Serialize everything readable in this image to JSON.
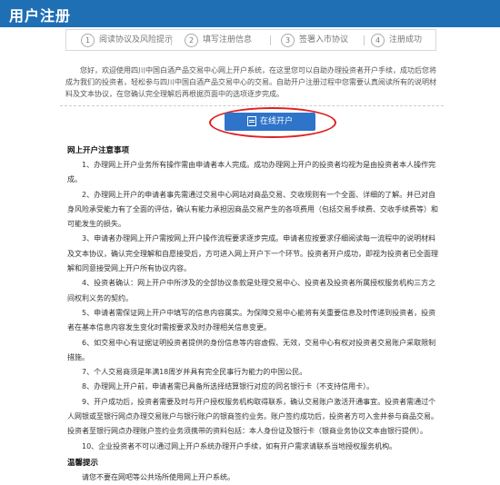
{
  "header": {
    "title": "用户注册"
  },
  "steps": [
    {
      "num": "1",
      "label": "阅读协议及风险提示"
    },
    {
      "num": "2",
      "label": "填写注册信息"
    },
    {
      "num": "3",
      "label": "签署入市协议"
    },
    {
      "num": "4",
      "label": "注册成功"
    }
  ],
  "intro": "您好，欢迎使用四川中国白酒产品交易中心网上开户系统，在这里您可以自助办理投资者开户手续，成功后您将成为我们的投资者，轻松参与四川中国白酒产品交易中心的交易。自助开户注册过程中您需要认真阅读所有的说明材料及文本协议，在您确认完全理解后再根据页面中的选项逐步完成。",
  "open_button": {
    "label": "在线开户",
    "icon": "document-icon"
  },
  "notice": {
    "title": "网上开户注意事项",
    "items": [
      "1、办理网上开户业务所有操作需由申请者本人完成。成功办理网上开户的投资者均视为是由投资者本人操作完成。",
      "2、办理网上开户的申请者事先需通过交易中心网站对商品交易、交收规则有一个全面、详细的了解。并已对自身风险承受能力有了全面的评估，确认有能力承担因商品交易产生的各项费用（包括交易手续费、交收手续费等）和可能发生的损失。",
      "3、申请者办理网上开户需按网上开户操作流程要求逐步完成。申请者应按要求仔细阅读每一流程中的说明材料及文本协议，确认完全理解和自愿接受后，方可进入网上开户下一个环节。投资者开户成功，即视为投资者已全面理解和同意接受网上开户所有协议内容。",
      "4、投资者确认：网上开户中所涉及的全部协议条款是处理交易中心、投资者及投资者所属授权服务机构三方之间权利义务的契约。",
      "5、申请者需保证网上开户中填写的信息内容属实。为保障交易中心能将有关重要信息及时传递到投资者，投资者在基本信息内容发生变化时需按要求及时办理相关信息变更。",
      "6、如交易中心有证据证明投资者提供的身份信息等内容虚假、无效，交易中心有权对投资者交易账户采取限制措施。",
      "7、个人交易商须是年满18周岁并具有完全民事行为能力的中国公民。",
      "8、办理网上开户前，申请者需已具备所选择结算银行对应的同名银行卡（不支持信用卡）。",
      "9、开户成功后，投资者需要及时与开户授权服务机构取得联系，确认交易账户激活开通事宜。投资者需通过个人网银或至银行网点办理交易账户与银行账户的银商签约业务。账户签约成功后，投资者方可入金并参与商品交易。投资者至银行网点办理账户签约业务须携带的资料包括：本人身份证及银行卡（银商业务协议文本由银行提供）。",
      "10、企业投资者不可以通过网上开户系统办理开户手续，如有开户需求请联系当地授权服务机构。"
    ],
    "tip_title": "温馨提示",
    "tip_text": "请您不要在网吧等公共场所使用网上开户系统。"
  }
}
